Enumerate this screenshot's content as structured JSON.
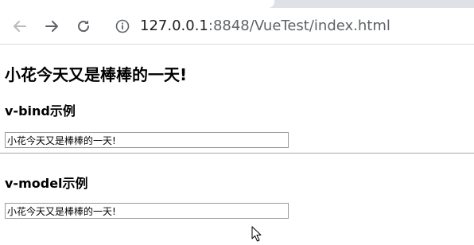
{
  "browser": {
    "url_host": "127.0.0.1",
    "url_rest": ":8848/VueTest/index.html",
    "icons": {
      "back": "arrow-left-icon",
      "forward": "arrow-right-icon",
      "reload": "reload-icon",
      "site_info": "info-icon"
    }
  },
  "page": {
    "title": "小花今天又是棒棒的一天!",
    "sections": [
      {
        "heading": "v-bind示例",
        "input_value": "小花今天又是棒棒的一天!"
      },
      {
        "heading": "v-model示例",
        "input_value": "小花今天又是棒棒的一天!"
      }
    ]
  },
  "colors": {
    "chrome_bg": "#dee1e6",
    "icon_gray": "#5f6368",
    "input_border": "#9a9a9a"
  }
}
